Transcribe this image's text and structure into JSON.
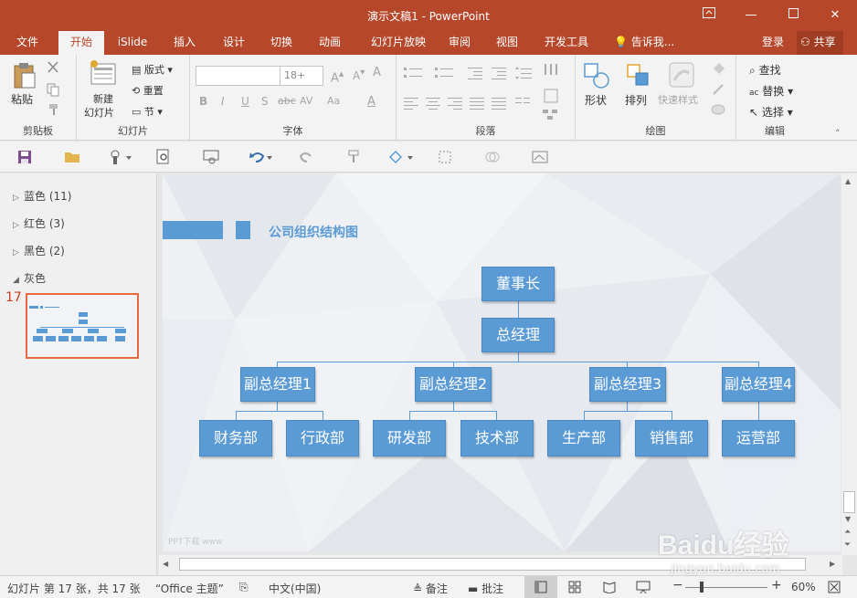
{
  "window": {
    "title": "演示文稿1 - PowerPoint"
  },
  "tabs": [
    "文件",
    "开始",
    "iSlide",
    "插入",
    "设计",
    "切换",
    "动画",
    "幻灯片放映",
    "审阅",
    "视图",
    "开发工具"
  ],
  "tell_me": "告诉我...",
  "login": "登录",
  "share": "共享",
  "ribbon": {
    "clipboard": {
      "label": "剪贴板",
      "paste": "粘贴"
    },
    "slides": {
      "label": "幻灯片",
      "new_slide_1": "新建",
      "new_slide_2": "幻灯片",
      "layout": "版式",
      "reset": "重置",
      "section": "节"
    },
    "font": {
      "label": "字体",
      "size": "18+",
      "bold": "B",
      "italic": "I",
      "underline": "U",
      "shadow": "S",
      "strike": "abc",
      "spacing": "AV",
      "case": "Aa",
      "color": "A"
    },
    "paragraph": {
      "label": "段落"
    },
    "drawing": {
      "label": "绘图",
      "shapes": "形状",
      "arrange": "排列",
      "quick_styles": "快速样式"
    },
    "editing": {
      "label": "编辑",
      "find": "查找",
      "replace": "替换",
      "select": "选择"
    }
  },
  "sections": [
    {
      "name": "蓝色 (11)",
      "arrow": "▷"
    },
    {
      "name": "红色 (3)",
      "arrow": "▷"
    },
    {
      "name": "黑色 (2)",
      "arrow": "▷"
    },
    {
      "name": "灰色",
      "arrow": "◢"
    }
  ],
  "slide_number": "17",
  "slide": {
    "title": "公司组织结构图",
    "chairman": "董事长",
    "gm": "总经理",
    "vps": [
      "副总经理1",
      "副总经理2",
      "副总经理3",
      "副总经理4"
    ],
    "departments": [
      "财务部",
      "行政部",
      "研发部",
      "技术部",
      "生产部",
      "销售部",
      "运营部"
    ],
    "footer": "PPT下载 www"
  },
  "status": {
    "slide_info": "幻灯片 第 17 张，共 17 张",
    "theme": "“Office 主题”",
    "language": "中文(中国)",
    "notes": "备注",
    "comments": "批注",
    "zoom": "60%"
  },
  "watermark": {
    "logo": "Baidu经验",
    "url": "jingyan.baidu.com"
  },
  "colors": {
    "accent": "#b7472a",
    "node": "#5b9bd5"
  }
}
